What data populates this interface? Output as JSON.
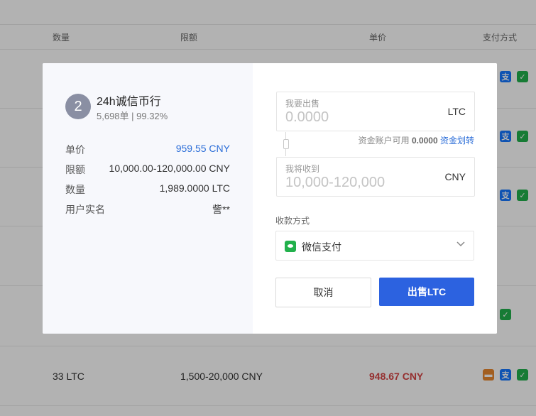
{
  "background_table": {
    "headers": {
      "quantity": "数量",
      "limit": "限额",
      "unit_price": "单价",
      "payment": "支付方式"
    },
    "visible_row": {
      "quantity": "33 LTC",
      "limit": "1,500-20,000 CNY",
      "price": "948.67 CNY"
    }
  },
  "merchant": {
    "rank": "2",
    "name": "24h诚信币行",
    "stats": "5,698单 | 99.32%"
  },
  "details": [
    {
      "label": "单价",
      "value": "959.55 CNY"
    },
    {
      "label": "限额",
      "value": "10,000.00-120,000.00 CNY"
    },
    {
      "label": "数量",
      "value": "1,989.0000 LTC"
    },
    {
      "label": "用户实名",
      "value": "訾**"
    }
  ],
  "sell_field": {
    "label": "我要出售",
    "placeholder": "0.0000",
    "unit": "LTC"
  },
  "available": {
    "text": "资金账户可用",
    "amount": "0.0000",
    "transfer_link": "资金划转"
  },
  "receive_field": {
    "label": "我将收到",
    "placeholder": "10,000-120,000",
    "unit": "CNY"
  },
  "payment_method": {
    "label": "收款方式",
    "selected": "微信支付"
  },
  "buttons": {
    "cancel": "取消",
    "sell": "出售LTC"
  },
  "colors": {
    "accent_blue": "#2c62e0",
    "price_red": "#d64545",
    "wechat_green": "#22b14c",
    "alipay_blue": "#1677ff",
    "bank_orange": "#e8872d"
  }
}
